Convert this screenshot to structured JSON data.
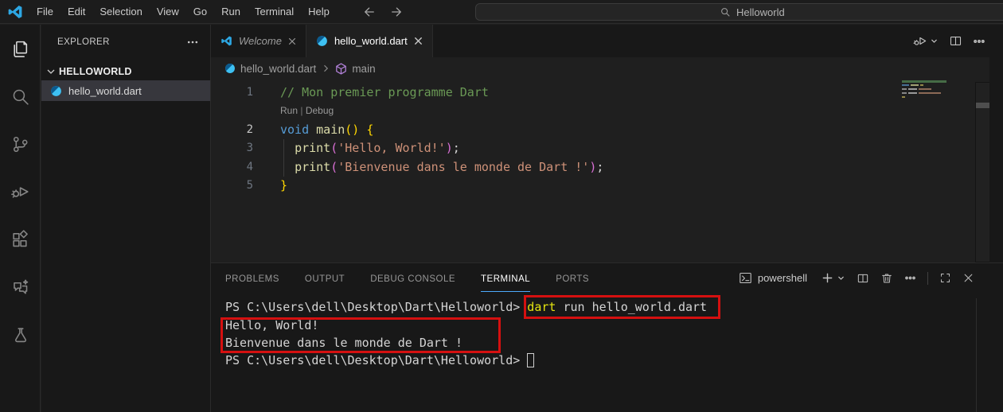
{
  "title_bar": {
    "menus": [
      "File",
      "Edit",
      "Selection",
      "View",
      "Go",
      "Run",
      "Terminal",
      "Help"
    ],
    "search": {
      "value": "Helloworld"
    }
  },
  "activity_bar": {
    "items": [
      "explorer",
      "search",
      "source-control",
      "run-and-debug",
      "extensions",
      "chat",
      "testing"
    ],
    "active_item": "explorer"
  },
  "sidebar": {
    "title": "EXPLORER",
    "more_label": "⋯",
    "section": {
      "label": "HELLOWORLD",
      "expanded": true
    },
    "files": [
      {
        "label": "hello_world.dart",
        "icon": "dart",
        "selected": true
      }
    ]
  },
  "editor_tabs": [
    {
      "label": "Welcome",
      "icon": "vscode-logo",
      "active": false
    },
    {
      "label": "hello_world.dart",
      "icon": "dart",
      "active": true
    }
  ],
  "breadcrumb": {
    "file": "hello_world.dart",
    "symbol": "main"
  },
  "editor": {
    "codelens": {
      "run": "Run",
      "separator": "|",
      "debug": "Debug"
    },
    "lines": [
      {
        "num": "1",
        "tokens": [
          {
            "t": "// Mon premier programme Dart",
            "c": "comment"
          }
        ]
      },
      {
        "lens": true
      },
      {
        "num": "2",
        "active": true,
        "tokens": [
          {
            "t": "void",
            "c": "kw"
          },
          {
            "t": " ",
            "c": "pl"
          },
          {
            "t": "main",
            "c": "fn"
          },
          {
            "t": "()",
            "c": "b1"
          },
          {
            "t": " ",
            "c": "pl"
          },
          {
            "t": "{",
            "c": "b1"
          }
        ]
      },
      {
        "num": "3",
        "tokens": [
          {
            "t": "  ",
            "c": "pl"
          },
          {
            "t": "print",
            "c": "fn"
          },
          {
            "t": "(",
            "c": "b2"
          },
          {
            "t": "'Hello, World!'",
            "c": "str"
          },
          {
            "t": ")",
            "c": "b2"
          },
          {
            "t": ";",
            "c": "pl"
          }
        ]
      },
      {
        "num": "4",
        "tokens": [
          {
            "t": "  ",
            "c": "pl"
          },
          {
            "t": "print",
            "c": "fn"
          },
          {
            "t": "(",
            "c": "b2"
          },
          {
            "t": "'Bienvenue dans le monde de Dart !'",
            "c": "str"
          },
          {
            "t": ")",
            "c": "b2"
          },
          {
            "t": ";",
            "c": "pl"
          }
        ]
      },
      {
        "num": "5",
        "tokens": [
          {
            "t": "}",
            "c": "b1"
          }
        ]
      }
    ]
  },
  "panel": {
    "tabs": [
      {
        "label": "PROBLEMS",
        "active": false
      },
      {
        "label": "OUTPUT",
        "active": false
      },
      {
        "label": "DEBUG CONSOLE",
        "active": false
      },
      {
        "label": "TERMINAL",
        "active": true
      },
      {
        "label": "PORTS",
        "active": false
      }
    ],
    "toolbar": {
      "shell_label": "powershell"
    },
    "terminal": {
      "lines": [
        {
          "tokens": [
            {
              "t": "PS C:\\Users\\dell\\Desktop\\Dart\\Helloworld> ",
              "c": "pl"
            },
            {
              "t": "dart",
              "c": "cmd"
            },
            {
              "t": " run hello_world.dart",
              "c": "pl"
            }
          ]
        },
        {
          "tokens": [
            {
              "t": "Hello, World!",
              "c": "pl"
            }
          ]
        },
        {
          "tokens": [
            {
              "t": "Bienvenue dans le monde de Dart !",
              "c": "pl"
            }
          ]
        },
        {
          "tokens": [
            {
              "t": "PS C:\\Users\\dell\\Desktop\\Dart\\Helloworld> ",
              "c": "pl"
            }
          ],
          "cursor": true
        }
      ]
    }
  },
  "annotations": [
    {
      "name": "command-highlight",
      "color": "#d51010"
    },
    {
      "name": "output-highlight",
      "color": "#d51010"
    }
  ],
  "colors": {
    "accent": "#4daafc",
    "annotation_red": "#d51010",
    "tokens": {
      "comment": "#6a9955",
      "kw": "#569cd6",
      "fn": "#dcdcaa",
      "b1": "#ffd700",
      "b2": "#da70d6",
      "str": "#ce9178",
      "pl": "#d4d4d4",
      "cmd": "#e5e510"
    }
  }
}
